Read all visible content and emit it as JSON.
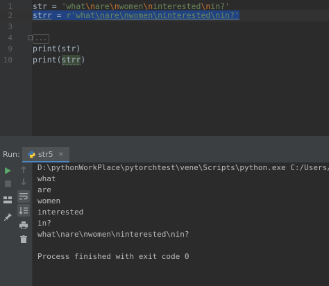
{
  "editor": {
    "lines": [
      {
        "num": "1",
        "var": "str",
        "eq": " = ",
        "pre": "'what",
        "e1": "\\n",
        "w1": "are",
        "e2": "\\n",
        "w2": "women",
        "e3": "\\n",
        "w3": "interested",
        "e4": "\\n",
        "w4": "in?'"
      },
      {
        "num": "2",
        "var": "strr",
        "eq": " = ",
        "pre": "r'what",
        "e1": "\\n",
        "w1": "are",
        "e2": "\\n",
        "w2": "women",
        "e3": "\\n",
        "w3": "interested",
        "e4": "\\n",
        "w4": "in?'"
      },
      {
        "num": "3"
      },
      {
        "num": "4",
        "folded": "..."
      },
      {
        "num": "9",
        "call": "print(str)"
      },
      {
        "num": "10",
        "fn": "print(",
        "arg": "strr",
        "close": ")"
      }
    ]
  },
  "run_panel": {
    "label": "Run:",
    "tab_label": "str5",
    "tab_close": "×",
    "console_lines": [
      "D:\\pythonWorkPlace\\pytorchtest\\vene\\Scripts\\python.exe C:/Users/hasee/",
      "what",
      "are",
      "women",
      "interested",
      "in?",
      "what\\nare\\nwomen\\ninterested\\nin?",
      "",
      "Process finished with exit code 0"
    ]
  },
  "icons": {
    "run": "run-icon",
    "stop": "stop-icon",
    "up": "arrow-up-icon",
    "down": "arrow-down-icon",
    "wrap": "soft-wrap-icon",
    "sort": "scroll-to-end-icon",
    "print": "print-icon",
    "trash": "trash-icon",
    "layout": "layout-icon",
    "pin": "pin-icon"
  },
  "colors": {
    "background": "#2b2b2b",
    "selection": "#214283",
    "string": "#6a8759",
    "escape": "#cc7832",
    "run_green": "#59a869",
    "stop_red": "#c75450"
  }
}
